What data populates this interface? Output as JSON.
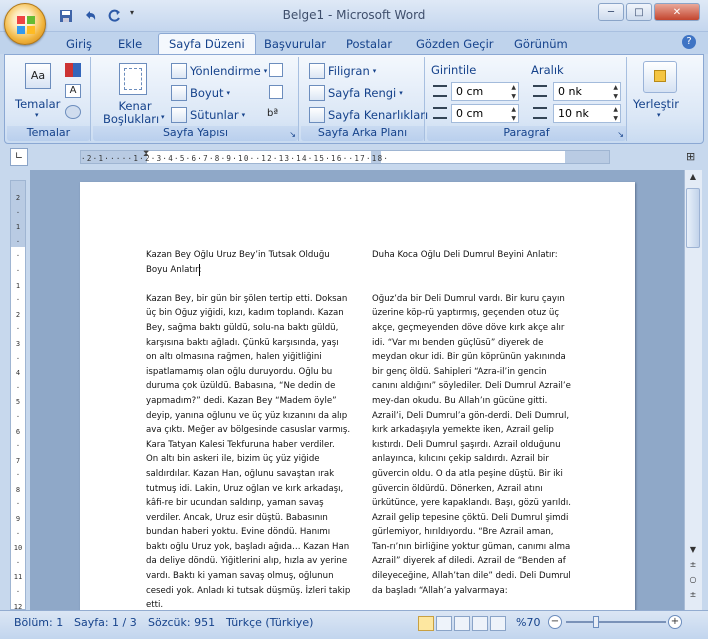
{
  "window": {
    "title": "Belge1 - Microsoft Word"
  },
  "tabs": [
    {
      "label": "Giriş"
    },
    {
      "label": "Ekle"
    },
    {
      "label": "Sayfa Düzeni"
    },
    {
      "label": "Başvurular"
    },
    {
      "label": "Postalar"
    },
    {
      "label": "Gözden Geçir"
    },
    {
      "label": "Görünüm"
    }
  ],
  "ribbon": {
    "themes": {
      "label": "Temalar",
      "group": "Temalar"
    },
    "page_setup": {
      "margins": "Kenar",
      "margins2": "Boşlukları",
      "orientation": "Yönlendirme",
      "size": "Boyut",
      "columns": "Sütunlar",
      "group": "Sayfa Yapısı"
    },
    "page_background": {
      "watermark": "Filigran",
      "page_color": "Sayfa Rengi",
      "page_borders": "Sayfa Kenarlıkları",
      "group": "Sayfa Arka Planı"
    },
    "paragraph": {
      "indent": "Girintile",
      "spacing": "Aralık",
      "indent_left": "0 cm",
      "indent_right": "0 cm",
      "space_before": "0 nk",
      "space_after": "10 nk",
      "group": "Paragraf"
    },
    "arrange": {
      "position": "Yerleştir"
    }
  },
  "document": {
    "col1_lines": [
      "Kazan Bey Oğlu Uruz Bey’in Tutsak Olduğu",
      "Boyu Anlatır:",
      "",
      "Kazan Bey, bir gün bir şölen tertip etti. Doksan",
      "üç bin Oğuz yiğidi, kızı, kadım toplandı.  Kazan",
      "Bey, sağma baktı güldü, solu-na baktı güldü,",
      "karşısına baktı ağladı. Çünkü karşısında, yaşı",
      "on altı olmasına  rağmen, halen yiğitliğini",
      "ispatlamamış olan oğlu duruyordu. Oğlu bu",
      "duruma çok üzüldü.  Babasına, “Ne dedin de",
      "yapmadım?” dedi. Kazan Bey “Madem öyle”",
      "deyip, yanına oğlunu ve üç yüz kızanını da alıp",
      "ava çıktı. Meğer av bölgesinde casuslar varmış.",
      "Kara Tatyan Kalesi Tekfuruna haber verdiler.",
      "On altı bin askeri ile, bizim üç yüz yiğide",
      "saldırdılar. Kazan Han, oğlunu savaştan ırak",
      "tutmuş idi.  Lakin, Uruz oğlan ve kırk arkadaşı,",
      "kâfi-re bir ucundan saldırıp, yaman savaş",
      "verdiler. Ancak, Uruz esir düştü.  Babasının",
      "bundan haberi yoktu. Evine döndü.  Hanımı",
      "baktı oğlu Uruz yok, başladı ağıda… Kazan Han",
      "da deliye döndü.  Yiğitlerini alıp, hızla av yerine",
      "vardı. Baktı ki yaman savaş olmuş, oğlunun",
      "cesedi yok. Anladı ki tutsak düşmüş. İzleri takip",
      "etti."
    ],
    "col2_lines": [
      "Duha Koca Oğlu Deli Dumrul Beyini Anlatır:",
      "",
      "",
      "Oğuz’da bir Deli Dumrul vardı. Bir kuru çayın",
      "üzerine köp-rü yaptırmış, geçenden otuz üç",
      "akçe, geçmeyenden döve döve kırk akçe alır",
      "idi. “Var mı benden güçlüsü” diyerek de",
      "meydan okur idi. Bir gün köprünün yakınında",
      "bir genç öldü. Sahipleri “Azra-il’in gencin",
      "canını aldığını” söylediler. Deli Dumrul Azrail’e",
      "mey-dan okudu.  Bu Allah’ın gücüne gitti.",
      "Azrail’i, Deli Dumrul’a gön-derdi. Deli Dumrul,",
      "kırk arkadaşıyla yemekte iken, Azrail gelip",
      "kıstırdı. Deli Dumrul şaşırdı. Azrail olduğunu",
      "anlayınca, kılıcını çekip saldırdı.  Azrail bir",
      "güvercin oldu.  O da atla peşine düştü.  Bir iki",
      "güvercin öldürdü.  Dönerken, Azrail atını",
      "ürkütünce, yere kapaklandı. Başı, gözü yarıldı.",
      "Azrail gelip tepesine  çöktü. Deli Dumrul şimdi",
      "gürlemiyor, hırıldıyordu.  “Bre Azrail aman,",
      "Tan-rı’nın birliğine  yoktur güman, canımı alma",
      "Azrail” diyerek af diledi.  Azrail de “Benden af",
      "dileyeceğine, Allah’tan dile”  dedi. Deli Dumrul",
      "da başladı  “Allah’a yalvarmaya:"
    ]
  },
  "status": {
    "section": "Bölüm: 1",
    "page": "Sayfa: 1 / 3",
    "words": "Sözcük: 951",
    "language": "Türkçe (Türkiye)",
    "zoom": "%70"
  },
  "colors": {
    "accent": "#15428b",
    "ribbon_bg": "#dbe7f6"
  }
}
